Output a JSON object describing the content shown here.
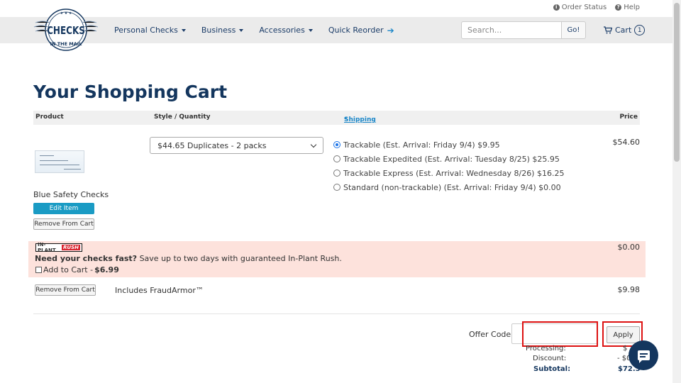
{
  "utility": {
    "order_status": "Order Status",
    "help": "Help"
  },
  "brand": {
    "logo_top": "CHECKS",
    "logo_bottom": "IN THE MAIL"
  },
  "nav": {
    "items": [
      {
        "label": "Personal Checks",
        "icon": "chevron-down-icon"
      },
      {
        "label": "Business",
        "icon": "chevron-down-icon"
      },
      {
        "label": "Accessories",
        "icon": "chevron-down-icon"
      },
      {
        "label": "Quick Reorder",
        "icon": "arrow-right-icon"
      }
    ],
    "search_placeholder": "Search...",
    "go_label": "Go!",
    "cart_label": "Cart",
    "cart_count": "1"
  },
  "page": {
    "title": "Your Shopping Cart"
  },
  "table": {
    "headers": {
      "product": "Product",
      "style": "Style / Quantity",
      "shipping": "Shipping",
      "shipping_mark": "*",
      "price": "Price"
    }
  },
  "item": {
    "name": "Blue Safety Checks",
    "edit_label": "Edit Item",
    "remove_label": "Remove From Cart",
    "style_selected": "$44.65 Duplicates - 2 packs",
    "price": "$54.60",
    "shipping_options": [
      {
        "label": "Trackable (Est. Arrival: Friday 9/4) $9.95",
        "selected": true
      },
      {
        "label": "Trackable Expedited (Est. Arrival: Tuesday 8/25) $25.95",
        "selected": false
      },
      {
        "label": "Trackable Express (Est. Arrival: Wednesday 8/26) $16.25",
        "selected": false
      },
      {
        "label": "Standard (non-trackable) (Est. Arrival: Friday 9/4) $0.00",
        "selected": false
      }
    ]
  },
  "rush": {
    "logo_a": "IN-PLANT",
    "logo_b": "RUSH",
    "headline": "Need your checks fast?",
    "text": " Save up to two days with guaranteed In-Plant Rush.",
    "add_label": "Add to Cart - ",
    "add_price": "$6.99",
    "price": "$0.00"
  },
  "fraud": {
    "remove_label": "Remove From Cart",
    "text": "Includes FraudArmor™",
    "price": "$9.98"
  },
  "offer": {
    "label": "Offer Code:",
    "value": "",
    "apply_label": "Apply"
  },
  "summary": {
    "processing_label": "Processing:",
    "processing_value": "$",
    "discount_label": "Discount:",
    "discount_value": "- $0",
    "subtotal_label": "Subtotal:",
    "subtotal_value": "$72.5"
  },
  "colors": {
    "brand_navy": "#14365e",
    "accent_blue": "#1a9bc4",
    "rush_bg": "#fde2dc",
    "highlight_red": "#dd1111"
  }
}
